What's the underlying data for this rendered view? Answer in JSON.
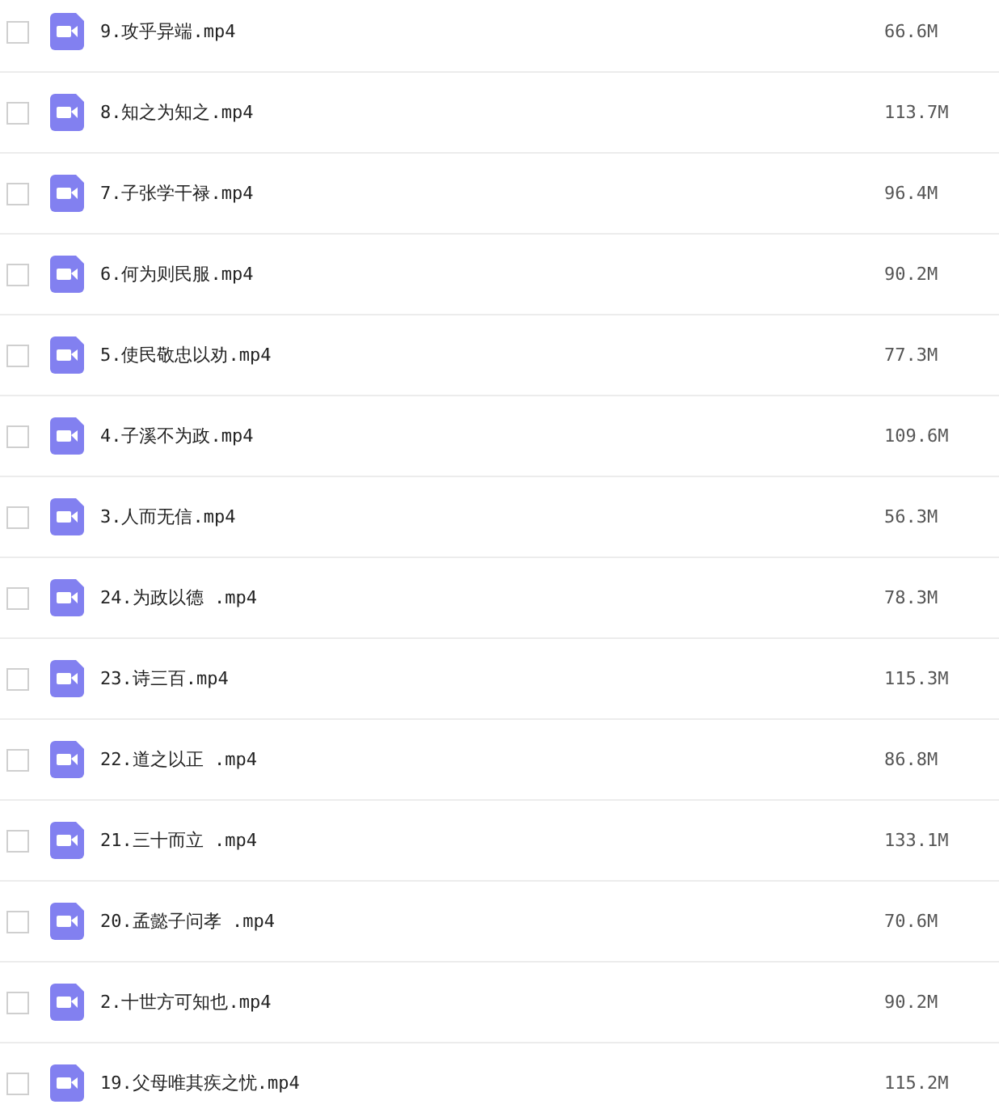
{
  "files": [
    {
      "name": "9.攻乎异端.mp4",
      "size": "66.6M",
      "checked": false
    },
    {
      "name": "8.知之为知之.mp4",
      "size": "113.7M",
      "checked": false
    },
    {
      "name": "7.子张学干禄.mp4",
      "size": "96.4M",
      "checked": false
    },
    {
      "name": "6.何为则民服.mp4",
      "size": "90.2M",
      "checked": false
    },
    {
      "name": "5.使民敬忠以劝.mp4",
      "size": "77.3M",
      "checked": false
    },
    {
      "name": "4.子溪不为政.mp4",
      "size": "109.6M",
      "checked": false
    },
    {
      "name": "3.人而无信.mp4",
      "size": "56.3M",
      "checked": false
    },
    {
      "name": "24.为政以德 .mp4",
      "size": "78.3M",
      "checked": false
    },
    {
      "name": "23.诗三百.mp4",
      "size": "115.3M",
      "checked": false
    },
    {
      "name": "22.道之以正 .mp4",
      "size": "86.8M",
      "checked": false
    },
    {
      "name": "21.三十而立 .mp4",
      "size": "133.1M",
      "checked": false
    },
    {
      "name": "20.孟懿子问孝 .mp4",
      "size": "70.6M",
      "checked": false
    },
    {
      "name": "2.十世方可知也.mp4",
      "size": "90.2M",
      "checked": false
    },
    {
      "name": "19.父母唯其疾之忧.mp4",
      "size": "115.2M",
      "checked": false
    }
  ]
}
